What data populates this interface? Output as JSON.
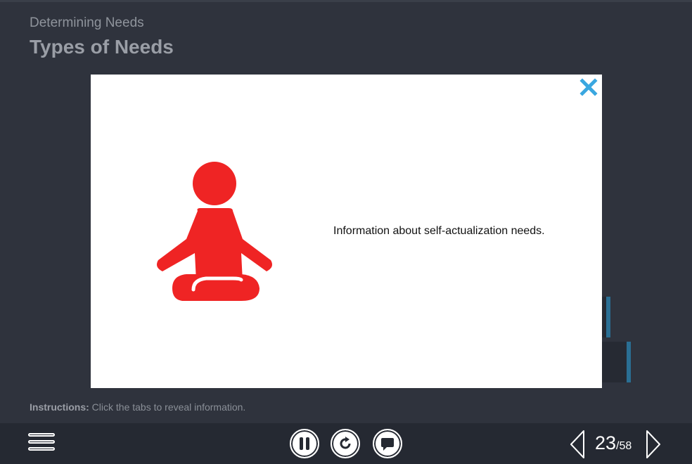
{
  "header": {
    "subtitle": "Determining Needs",
    "title": "Types of Needs"
  },
  "modal": {
    "icon": "meditation-person-icon",
    "text": "Information about self-actualization needs.",
    "close_icon": "close-icon"
  },
  "instructions": {
    "label": "Instructions:",
    "text": " Click the tabs to reveal information."
  },
  "controls": {
    "menu_icon": "hamburger-menu-icon",
    "pause_icon": "pause-icon",
    "replay_icon": "replay-icon",
    "captions_icon": "speech-bubble-icon",
    "prev_icon": "chevron-left-icon",
    "next_icon": "chevron-right-icon",
    "current_page": "23",
    "total_pages": "/58"
  },
  "colors": {
    "background": "#2f333d",
    "control_bar": "#252932",
    "figure": "#ef2424",
    "close": "#3aa7e0",
    "tab_accent": "#2a6f94"
  }
}
